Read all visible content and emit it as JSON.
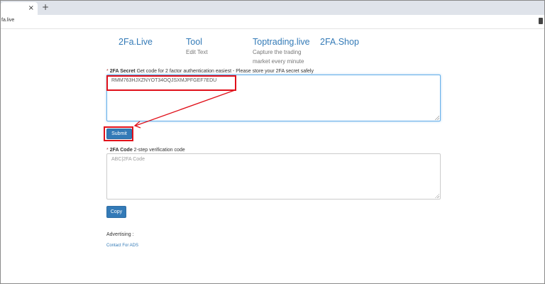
{
  "browser": {
    "tab_close": "×",
    "new_tab": "+",
    "url": "fa.live"
  },
  "nav": [
    {
      "label": "2Fa.Live",
      "sub": []
    },
    {
      "label": "Tool",
      "sub": [
        "Edit Text"
      ]
    },
    {
      "label": "Toptrading.live",
      "sub": [
        "Capture the trading",
        "market every minute"
      ]
    },
    {
      "label": "2FA.Shop",
      "sub": []
    }
  ],
  "secret": {
    "required_mark": "*",
    "label": "2FA Secret",
    "help": "Get code for 2 factor authentication easiest - Please store your 2FA secret safely",
    "value": "RMM763HJXZNYOT34OQJSXMJPFGEF7EDU"
  },
  "submit_label": "Submit",
  "code": {
    "required_mark": "*",
    "label": "2FA Code",
    "help": "2-step verification code",
    "placeholder": "ABC|2FA Code"
  },
  "copy_label": "Copy",
  "advertising_label": "Advertising :",
  "contact_link": "Contact For ADS",
  "colors": {
    "link": "#337ab7",
    "button": "#337ab7",
    "annotation": "#e0101a"
  }
}
